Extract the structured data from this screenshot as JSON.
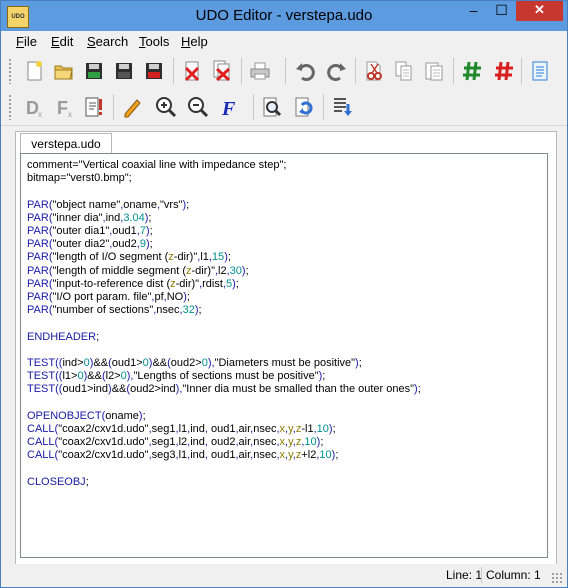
{
  "window": {
    "title": "UDO Editor - verstepa.udo",
    "logo_text": "UDO"
  },
  "title_controls": {
    "minimize": "–",
    "maximize": "☐",
    "close": "✕"
  },
  "menu": [
    {
      "label": "File",
      "key": "F",
      "rest": "ile"
    },
    {
      "label": "Edit",
      "key": "E",
      "rest": "dit"
    },
    {
      "label": "Search",
      "key": "S",
      "rest": "earch"
    },
    {
      "label": "Tools",
      "key": "T",
      "rest": "ools"
    },
    {
      "label": "Help",
      "key": "H",
      "rest": "elp"
    }
  ],
  "toolbar1_icons": [
    "new-file-icon",
    "open-folder-icon",
    "save-green-icon",
    "save-dark-icon",
    "save-red-icon",
    "close-file-icon",
    "close-all-icon",
    "print-icon",
    "undo-icon",
    "redo-icon",
    "cut-icon",
    "copy-icon",
    "paste-icon",
    "hash-green-icon",
    "hash-red-icon",
    "notes-icon"
  ],
  "toolbar2_icons": [
    "d-icon",
    "f-icon",
    "doc-check-icon",
    "pencil-icon",
    "zoom-in-icon",
    "zoom-out-icon",
    "font-icon",
    "search-doc-icon",
    "replace-icon",
    "list-down-icon"
  ],
  "tab": {
    "label": "verstepa.udo"
  },
  "colors": {
    "keyword": "#1a1aa6",
    "number": "#009090",
    "xyz": "#8a7a00",
    "title_bar": "#5d9be0"
  },
  "code_lines": [
    "comment=\"Vertical coaxial line with impedance step\";",
    "bitmap=\"verst0.bmp\";",
    "",
    "PAR(\"object name\",oname,\"vrs\");",
    "PAR(\"inner dia\",ind,3.04);",
    "PAR(\"outer dia1\",oud1,7);",
    "PAR(\"outer dia2\",oud2,9);",
    "PAR(\"length of I/O segment (z-dir)\",l1,15);",
    "PAR(\"length of middle segment (z-dir)\",l2,30);",
    "PAR(\"input-to-reference dist (z-dir)\",rdist,5);",
    "PAR(\"I/O port param. file\",pf,NO);",
    "PAR(\"number of sections\",nsec,32);",
    "",
    "ENDHEADER;",
    "",
    "TEST((ind>0)&&(oud1>0)&&(oud2>0),\"Diameters must be positive\");",
    "TEST((l1>0)&&(l2>0),\"Lengths of sections must be positive\");",
    "TEST((oud1>ind)&&(oud2>ind),\"Inner dia must be smalled than the outer ones\");",
    "",
    "OPENOBJECT(oname);",
    "CALL(\"coax2/cxv1d.udo\",seg1,l1,ind, oud1,air,nsec,x,y,z-l1,10);",
    "CALL(\"coax2/cxv1d.udo\",seg1,l2,ind, oud2,air,nsec,x,y,z,10);",
    "CALL(\"coax2/cxv1d.udo\",seg3,l1,ind, oud1,air,nsec,x,y,z+l2,10);",
    "",
    "CLOSEOBJ;"
  ],
  "status": {
    "line": "Line: 1",
    "column": "Column: 1"
  }
}
